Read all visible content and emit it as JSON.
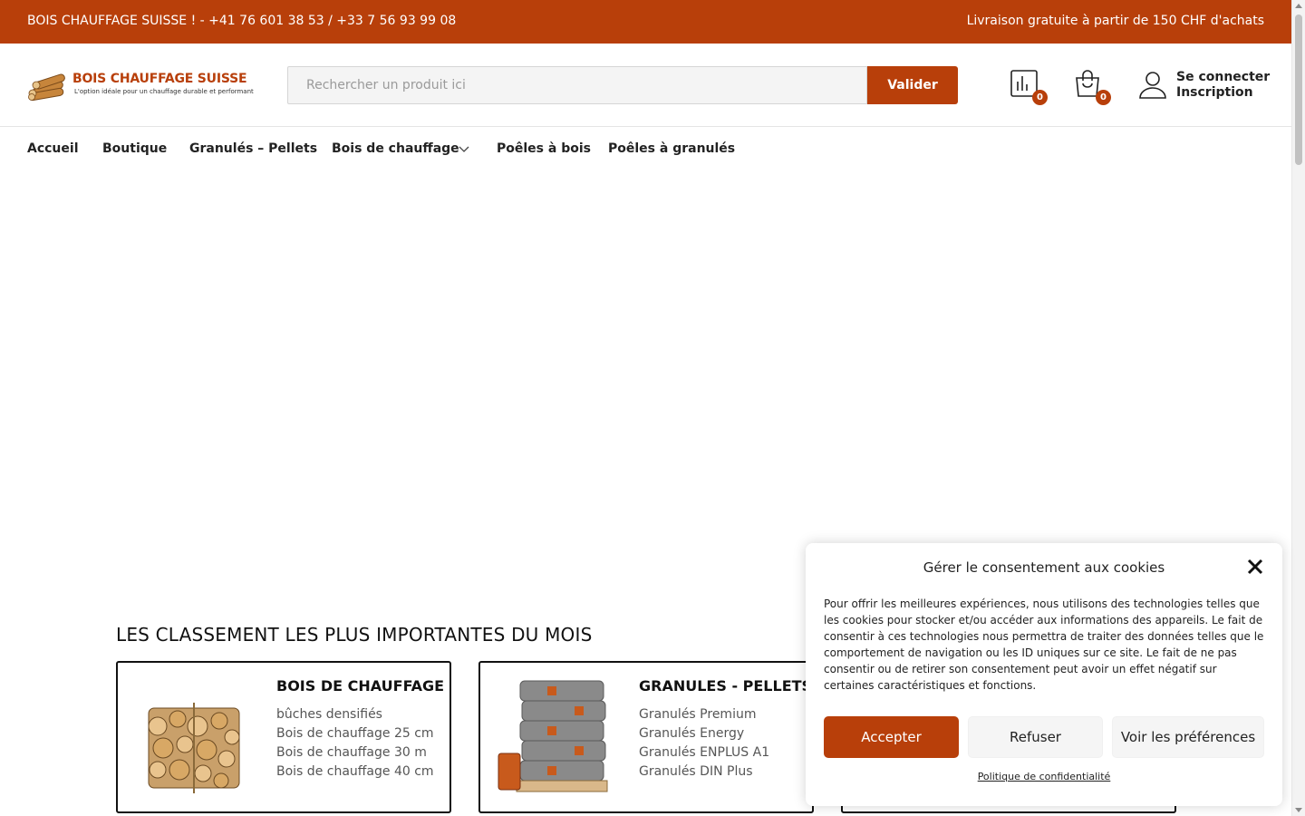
{
  "topbar": {
    "left_text": "BOIS CHAUFFAGE SUISSE ! - +41 76 601 38 53 / +33 7 56 93 99 08",
    "right_text": "Livraison gratuite à partir de 150 CHF d'achats"
  },
  "header": {
    "logo": {
      "brand": "BOIS CHAUFFAGE SUISSE",
      "tagline": "L'option idéale pour un chauffage durable et performant"
    },
    "search": {
      "placeholder": "Rechercher un produit ici",
      "button_label": "Valider"
    },
    "compare": {
      "icon": "bar-chart-icon",
      "count": "0"
    },
    "cart": {
      "icon": "shopping-bag-icon",
      "count": "0"
    },
    "account": {
      "icon": "user-icon",
      "login": "Se connecter",
      "register": "Inscription"
    }
  },
  "nav": {
    "items": [
      {
        "label": "Accueil"
      },
      {
        "label": "Boutique"
      },
      {
        "label": "Granulés – Pellets"
      },
      {
        "label": "Bois de chauffage",
        "has_dropdown": true
      },
      {
        "label": "Poêles à bois"
      },
      {
        "label": "Poêles à granulés"
      }
    ]
  },
  "ranking": {
    "title": "LES CLASSEMENT LES PLUS IMPORTANTES DU MOIS",
    "cards": [
      {
        "title": "BOIS DE CHAUFFAGE",
        "image": "firewood-bundle-image",
        "items": [
          "bûches densifiés",
          "Bois de chauffage 25 cm",
          "Bois de chauffage 30 m",
          "Bois de chauffage 40 cm"
        ]
      },
      {
        "title": "GRANULES - PELLETS",
        "image": "pellet-bags-pallet-image",
        "items": [
          "Granulés Premium",
          "Granulés Energy",
          "Granulés ENPLUS A1",
          "Granulés DIN Plus"
        ]
      }
    ]
  },
  "cookie_banner": {
    "title": "Gérer le consentement aux cookies",
    "body": "Pour offrir les meilleures expériences, nous utilisons des technologies telles que les cookies pour stocker et/ou accéder aux informations des appareils. Le fait de consentir à ces technologies nous permettra de traiter des données telles que le comportement de navigation ou les ID uniques sur ce site. Le fait de ne pas consentir ou de retirer son consentement peut avoir un effet négatif sur certaines caractéristiques et fonctions.",
    "accept": "Accepter",
    "refuse": "Refuser",
    "preferences": "Voir les préférences",
    "policy_link": "Politique de confidentialité"
  },
  "colors": {
    "brand": "#b83f0a",
    "text": "#222222",
    "muted": "#555555"
  }
}
